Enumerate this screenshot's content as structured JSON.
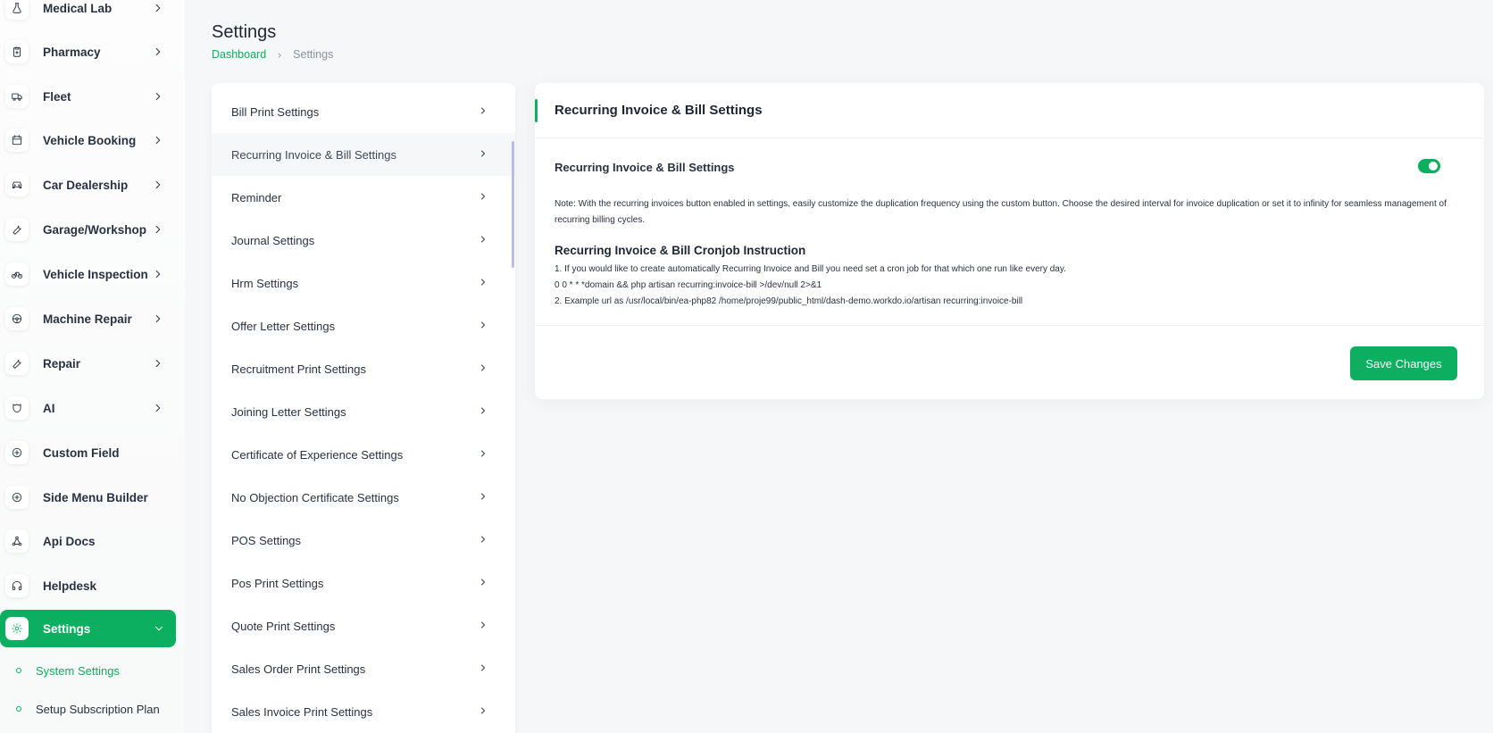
{
  "sidebar": {
    "items": [
      {
        "label": "Medical Lab",
        "icon": "flask-icon"
      },
      {
        "label": "Pharmacy",
        "icon": "clipboard-icon"
      },
      {
        "label": "Fleet",
        "icon": "truck-icon"
      },
      {
        "label": "Vehicle Booking",
        "icon": "calendar-icon"
      },
      {
        "label": "Car Dealership",
        "icon": "car-icon"
      },
      {
        "label": "Garage/Workshop",
        "icon": "wrench-icon"
      },
      {
        "label": "Vehicle Inspection",
        "icon": "bicycle-icon"
      },
      {
        "label": "Machine Repair",
        "icon": "steering-icon"
      },
      {
        "label": "Repair",
        "icon": "tool-icon"
      },
      {
        "label": "AI",
        "icon": "brain-icon"
      },
      {
        "label": "Custom Field",
        "icon": "plus-circle-icon"
      },
      {
        "label": "Side Menu Builder",
        "icon": "plus-circle-icon"
      },
      {
        "label": "Api Docs",
        "icon": "network-icon"
      },
      {
        "label": "Helpdesk",
        "icon": "headphones-icon"
      },
      {
        "label": "Settings",
        "icon": "gear-icon"
      }
    ],
    "sub_items": [
      {
        "label": "System Settings"
      },
      {
        "label": "Setup Subscription Plan"
      }
    ]
  },
  "header": {
    "title": "Settings",
    "breadcrumb": {
      "home": "Dashboard",
      "current": "Settings"
    }
  },
  "settings_list": [
    "Bill Print Settings",
    "Recurring Invoice & Bill Settings",
    "Reminder",
    "Journal Settings",
    "Hrm Settings",
    "Offer Letter Settings",
    "Recruitment Print Settings",
    "Joining Letter Settings",
    "Certificate of Experience Settings",
    "No Objection Certificate Settings",
    "POS Settings",
    "Pos Print Settings",
    "Quote Print Settings",
    "Sales Order Print Settings",
    "Sales Invoice Print Settings"
  ],
  "card": {
    "title": "Recurring Invoice & Bill Settings",
    "option_label": "Recurring Invoice & Bill Settings",
    "toggle_on": true,
    "note": "Note: With the recurring invoices button enabled in settings, easily customize the duplication frequency using the custom button. Choose the desired interval for invoice duplication or set it to infinity for seamless management of recurring billing cycles.",
    "cron_title": "Recurring Invoice & Bill Cronjob Instruction",
    "cron_lines": [
      "1. If you would like to create automatically Recurring Invoice and Bill you need set a cron job for that which one run like every day.",
      "0 0 * * *domain && php artisan recurring:invoice-bill >/dev/null 2>&1",
      "2. Example url as /usr/local/bin/ea-php82 /home/proje99/public_html/dash-demo.workdo.io/artisan recurring:invoice-bill"
    ],
    "save_label": "Save Changes"
  },
  "colors": {
    "accent": "#0caf60",
    "text": "#293240",
    "muted": "#8a93a0"
  }
}
